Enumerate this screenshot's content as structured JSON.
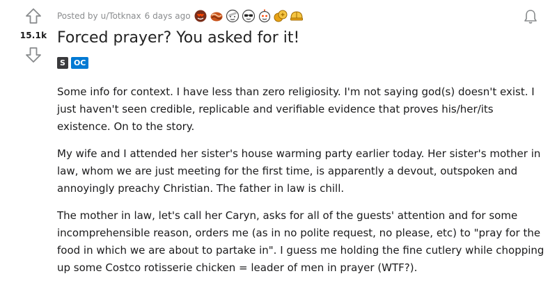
{
  "post": {
    "score": "15.1k",
    "posted_by_prefix": "Posted by",
    "author": "u/Totknax",
    "time_ago": "6 days ago",
    "title": "Forced prayer? You asked for it!",
    "flairs": [
      {
        "label": "S",
        "color": "#3a3a3c"
      },
      {
        "label": "OC",
        "color": "#0079d3"
      }
    ],
    "awards": [
      "heart-eyes-award-icon",
      "bacon-award-icon",
      "bandage-face-award-icon",
      "glasses-face-award-icon",
      "robot-award-icon",
      "gold-coins-award-icon",
      "helmet-award-icon"
    ],
    "paragraphs": [
      "Some info for context. I have less than zero religiosity. I'm not saying god(s) doesn't exist. I just haven't seen credible, replicable and verifiable evidence that proves his/her/its existence. On to the story.",
      "My wife and I attended her sister's house warming party earlier today. Her sister's mother in law, whom we are just meeting for the first time, is apparently a devout, outspoken and annoyingly preachy Christian. The father in law is chill.",
      "The mother in law, let's call her Caryn, asks for all of the guests' attention and for some incomprehensible reason, orders me (as in no polite request, no please, etc) to \"pray for the food in which we are about to partake in\". I guess me holding the fine cutlery while chopping up some Costco rotisserie chicken = leader of men in prayer (WTF?)."
    ]
  },
  "colors": {
    "text": "#1a1a1b",
    "meta": "#8a8c8e",
    "arrow": "#878a8c",
    "oc_flair": "#0079d3",
    "spoiler_flair": "#3a3a3c"
  }
}
